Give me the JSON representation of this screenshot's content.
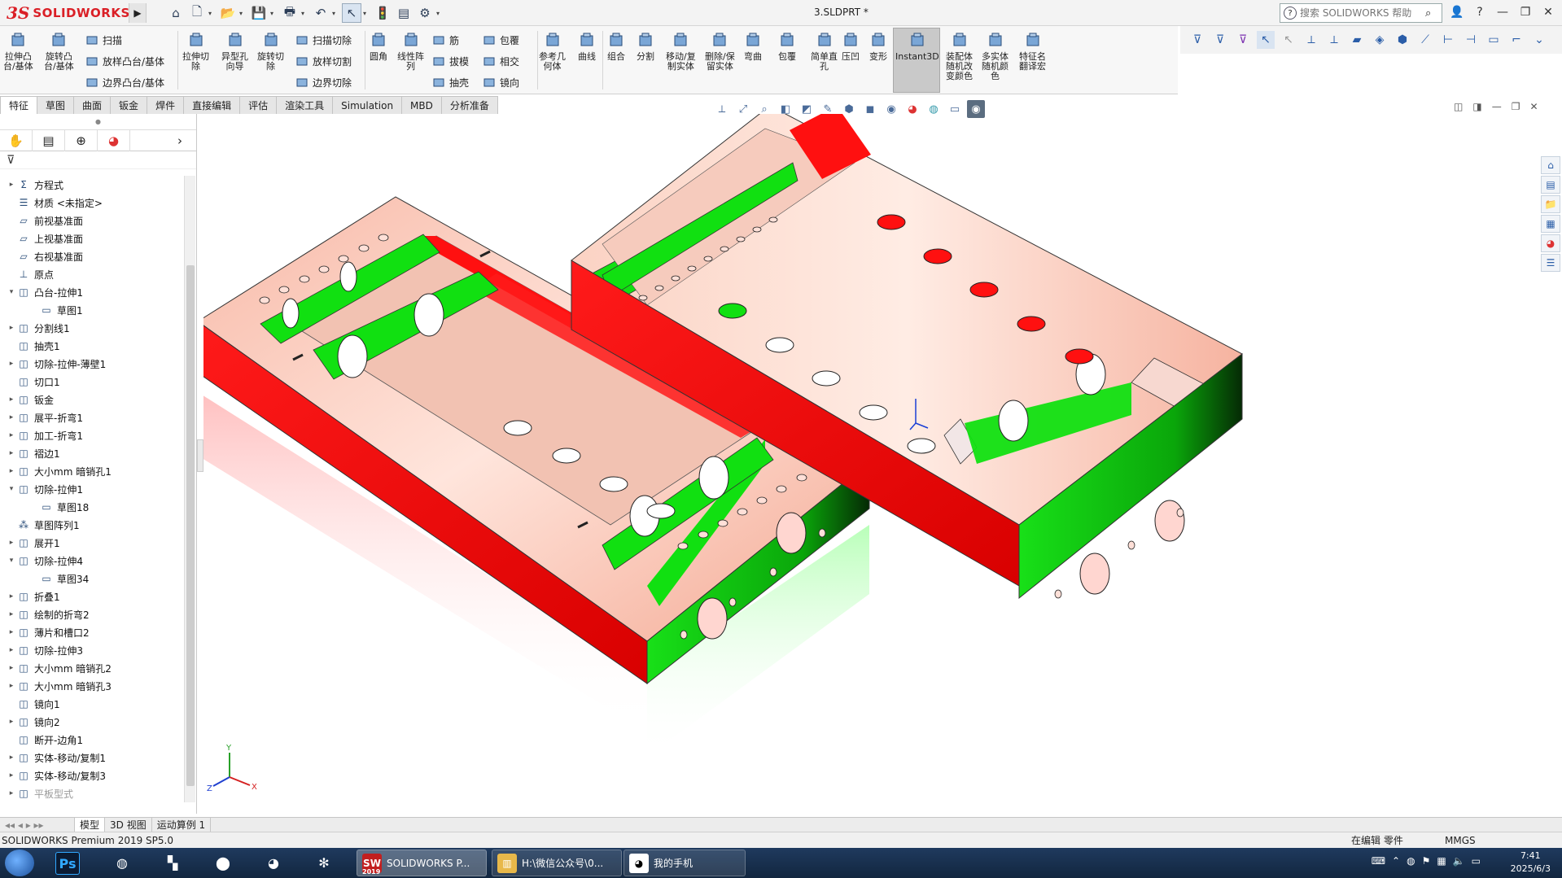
{
  "app": {
    "logo_ds": "3S",
    "logo_text": "SOLIDWORKS",
    "doc_title": "3.SLDPRT *",
    "search_placeholder": "搜索 SOLIDWORKS 帮助"
  },
  "ribbon": {
    "big": [
      {
        "label": "拉伸凸\n台/基体",
        "icon": "extrude-boss-icon"
      },
      {
        "label": "旋转凸\n台/基体",
        "icon": "revolve-boss-icon"
      },
      {
        "label": "拉伸切\n除",
        "icon": "extrude-cut-icon"
      },
      {
        "label": "异型孔\n向导",
        "icon": "hole-wizard-icon"
      },
      {
        "label": "旋转切\n除",
        "icon": "revolve-cut-icon"
      },
      {
        "label": "圆角",
        "icon": "fillet-icon"
      },
      {
        "label": "线性阵\n列",
        "icon": "linear-pattern-icon"
      },
      {
        "label": "参考几\n何体",
        "icon": "reference-geometry-icon"
      },
      {
        "label": "曲线",
        "icon": "curves-icon"
      },
      {
        "label": "组合",
        "icon": "combine-icon"
      },
      {
        "label": "分割",
        "icon": "split-icon"
      },
      {
        "label": "移动/复\n制实体",
        "icon": "move-copy-body-icon"
      },
      {
        "label": "删除/保\n留实体",
        "icon": "delete-keep-body-icon"
      },
      {
        "label": "弯曲",
        "icon": "flex-icon"
      },
      {
        "label": "包覆",
        "icon": "wrap-icon"
      },
      {
        "label": "简单直\n孔",
        "icon": "simple-hole-icon"
      },
      {
        "label": "压凹",
        "icon": "indent-icon"
      },
      {
        "label": "变形",
        "icon": "deform-icon"
      },
      {
        "label": "Instant3D",
        "icon": "instant3d-icon"
      },
      {
        "label": "装配体\n随机改\n变颜色",
        "icon": "assembly-random-color-icon"
      },
      {
        "label": "多实体\n随机颜\n色",
        "icon": "multibody-random-color-icon"
      },
      {
        "label": "特征名\n翻译宏",
        "icon": "feature-name-macro-icon"
      }
    ],
    "small": [
      {
        "label": "扫描",
        "icon": "sweep-icon"
      },
      {
        "label": "放样凸台/基体",
        "icon": "loft-icon"
      },
      {
        "label": "边界凸台/基体",
        "icon": "boundary-boss-icon"
      },
      {
        "label": "扫描切除",
        "icon": "swept-cut-icon"
      },
      {
        "label": "放样切割",
        "icon": "lofted-cut-icon"
      },
      {
        "label": "边界切除",
        "icon": "boundary-cut-icon"
      },
      {
        "label": "筋",
        "icon": "rib-icon"
      },
      {
        "label": "拔模",
        "icon": "draft-icon"
      },
      {
        "label": "抽壳",
        "icon": "shell-icon"
      },
      {
        "label": "包覆",
        "icon": "wrap-small-icon"
      },
      {
        "label": "相交",
        "icon": "intersect-icon"
      },
      {
        "label": "镜向",
        "icon": "mirror-icon"
      }
    ]
  },
  "cmtabs": [
    "特征",
    "草图",
    "曲面",
    "钣金",
    "焊件",
    "直接编辑",
    "评估",
    "渲染工具",
    "Simulation",
    "MBD",
    "分析准备"
  ],
  "tree": [
    {
      "label": "方程式",
      "exp": "▸",
      "icon": "equations-icon"
    },
    {
      "label": "材质 <未指定>",
      "exp": "",
      "icon": "material-icon"
    },
    {
      "label": "前视基准面",
      "exp": "",
      "icon": "plane-icon"
    },
    {
      "label": "上视基准面",
      "exp": "",
      "icon": "plane-icon"
    },
    {
      "label": "右视基准面",
      "exp": "",
      "icon": "plane-icon"
    },
    {
      "label": "原点",
      "exp": "",
      "icon": "origin-icon"
    },
    {
      "label": "凸台-拉伸1",
      "exp": "▾",
      "icon": "extrude-feature-icon"
    },
    {
      "label": "草图1",
      "exp": "",
      "icon": "sketch-icon",
      "indent": true
    },
    {
      "label": "分割线1",
      "exp": "▸",
      "icon": "split-line-icon"
    },
    {
      "label": "抽壳1",
      "exp": "",
      "icon": "shell-feature-icon"
    },
    {
      "label": "切除-拉伸-薄壁1",
      "exp": "▸",
      "icon": "cut-thin-icon"
    },
    {
      "label": "切口1",
      "exp": "",
      "icon": "rip-icon"
    },
    {
      "label": "钣金",
      "exp": "▸",
      "icon": "sheetmetal-icon"
    },
    {
      "label": "展平-折弯1",
      "exp": "▸",
      "icon": "flatten-bend-icon"
    },
    {
      "label": "加工-折弯1",
      "exp": "▸",
      "icon": "process-bend-icon"
    },
    {
      "label": "褶边1",
      "exp": "▸",
      "icon": "hem-icon"
    },
    {
      "label": "大小mm 暗销孔1",
      "exp": "▸",
      "icon": "dowel-hole-icon"
    },
    {
      "label": "切除-拉伸1",
      "exp": "▾",
      "icon": "cut-extrude-icon"
    },
    {
      "label": "草图18",
      "exp": "",
      "icon": "sketch-icon",
      "indent": true
    },
    {
      "label": "草图阵列1",
      "exp": "",
      "icon": "sketch-pattern-icon"
    },
    {
      "label": "展开1",
      "exp": "▸",
      "icon": "unfold-icon"
    },
    {
      "label": "切除-拉伸4",
      "exp": "▾",
      "icon": "cut-extrude-icon"
    },
    {
      "label": "草图34",
      "exp": "",
      "icon": "sketch-icon",
      "indent": true
    },
    {
      "label": "折叠1",
      "exp": "▸",
      "icon": "fold-icon"
    },
    {
      "label": "绘制的折弯2",
      "exp": "▸",
      "icon": "sketched-bend-icon"
    },
    {
      "label": "薄片和槽口2",
      "exp": "▸",
      "icon": "tab-slot-icon"
    },
    {
      "label": "切除-拉伸3",
      "exp": "▸",
      "icon": "cut-extrude-icon"
    },
    {
      "label": "大小mm 暗销孔2",
      "exp": "▸",
      "icon": "dowel-hole-icon"
    },
    {
      "label": "大小mm 暗销孔3",
      "exp": "▸",
      "icon": "dowel-hole-icon"
    },
    {
      "label": "镜向1",
      "exp": "",
      "icon": "mirror-feature-icon"
    },
    {
      "label": "镜向2",
      "exp": "▸",
      "icon": "mirror-feature-icon"
    },
    {
      "label": "断开-边角1",
      "exp": "",
      "icon": "break-corner-icon"
    },
    {
      "label": "实体-移动/复制1",
      "exp": "▸",
      "icon": "move-body-icon"
    },
    {
      "label": "实体-移动/复制3",
      "exp": "▸",
      "icon": "move-body-icon"
    },
    {
      "label": "平板型式",
      "exp": "▸",
      "icon": "flat-pattern-icon",
      "grey": true
    }
  ],
  "bottomtabs": [
    "模型",
    "3D 视图",
    "运动算例 1"
  ],
  "status": {
    "left": "SOLIDWORKS Premium 2019 SP5.0",
    "edit": "在编辑 零件",
    "units": "MMGS"
  },
  "taskbar": {
    "windows": [
      {
        "label": "SOLIDWORKS P...",
        "badge": "2019"
      },
      {
        "label": "H:\\微信公众号\\0..."
      },
      {
        "label": "我的手机"
      }
    ],
    "time": "7:41",
    "date": "2025/6/3"
  },
  "colors": {
    "accent_red": "#ff1010",
    "accent_green": "#00ee00",
    "brand": "#da1f26"
  }
}
